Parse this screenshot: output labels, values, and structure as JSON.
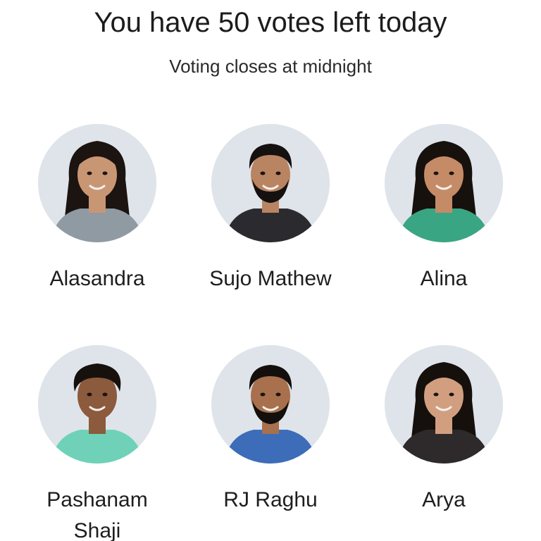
{
  "header": {
    "title": "You have 50 votes left today",
    "subtitle": "Voting closes at midnight"
  },
  "contestants": [
    {
      "name": "Alasandra",
      "hair": "#1b1410",
      "skin": "#c99674",
      "outfit": "#8f9aa3",
      "hair_style": "long"
    },
    {
      "name": "Sujo Mathew",
      "hair": "#151110",
      "skin": "#b98462",
      "outfit": "#2b2b2f",
      "hair_style": "short-beard"
    },
    {
      "name": "Alina",
      "hair": "#17110d",
      "skin": "#c58b66",
      "outfit": "#3aa583",
      "hair_style": "long"
    },
    {
      "name": "Pashanam Shaji",
      "hair": "#17110e",
      "skin": "#8c5a3c",
      "outfit": "#6fd2b8",
      "hair_style": "curly"
    },
    {
      "name": "RJ Raghu",
      "hair": "#120f0d",
      "skin": "#a8704d",
      "outfit": "#3d6db8",
      "hair_style": "short-beard"
    },
    {
      "name": "Arya",
      "hair": "#16100c",
      "skin": "#d19f80",
      "outfit": "#2e2a2c",
      "hair_style": "long"
    }
  ]
}
